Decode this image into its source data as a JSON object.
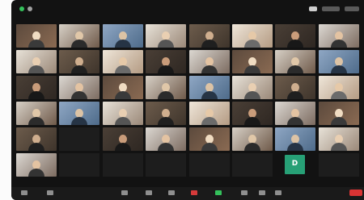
{
  "window": {
    "title": ""
  },
  "participant_names": [
    "",
    "",
    "",
    "",
    "",
    "",
    "",
    ""
  ],
  "green_avatar": {
    "initial": "D",
    "color": "#27a076"
  },
  "toolbar": {
    "end_color": "#d93434",
    "icons": [
      "mute-icon",
      "video-icon",
      "security-icon",
      "participants-icon",
      "chat-icon",
      "share-screen-icon",
      "record-icon",
      "reactions-icon",
      "apps-icon",
      "more-icon"
    ]
  },
  "top_indicators": {
    "colors": [
      "#34c05b",
      "#cccccc",
      "#cccccc"
    ]
  }
}
